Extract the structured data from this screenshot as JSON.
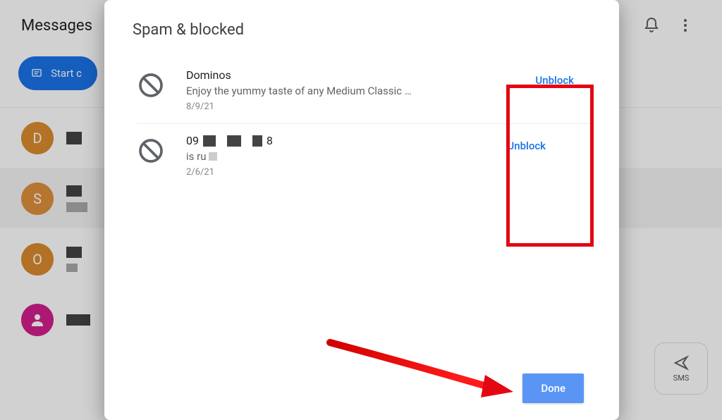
{
  "background": {
    "title": "Messages",
    "start_button": "Start c",
    "avatars": [
      "D",
      "S",
      "O",
      ""
    ],
    "sms_label": "SMS"
  },
  "dialog": {
    "title": "Spam & blocked",
    "entries": [
      {
        "name": "Dominos",
        "message": "Enjoy the yummy taste of any Medium Classic …",
        "date": "8/9/21",
        "action": "Unblock"
      },
      {
        "name_prefix": "09",
        "name_suffix": "8",
        "message_prefix": "is ru",
        "date": "2/6/21",
        "action": "Unblock"
      }
    ],
    "done": "Done"
  }
}
